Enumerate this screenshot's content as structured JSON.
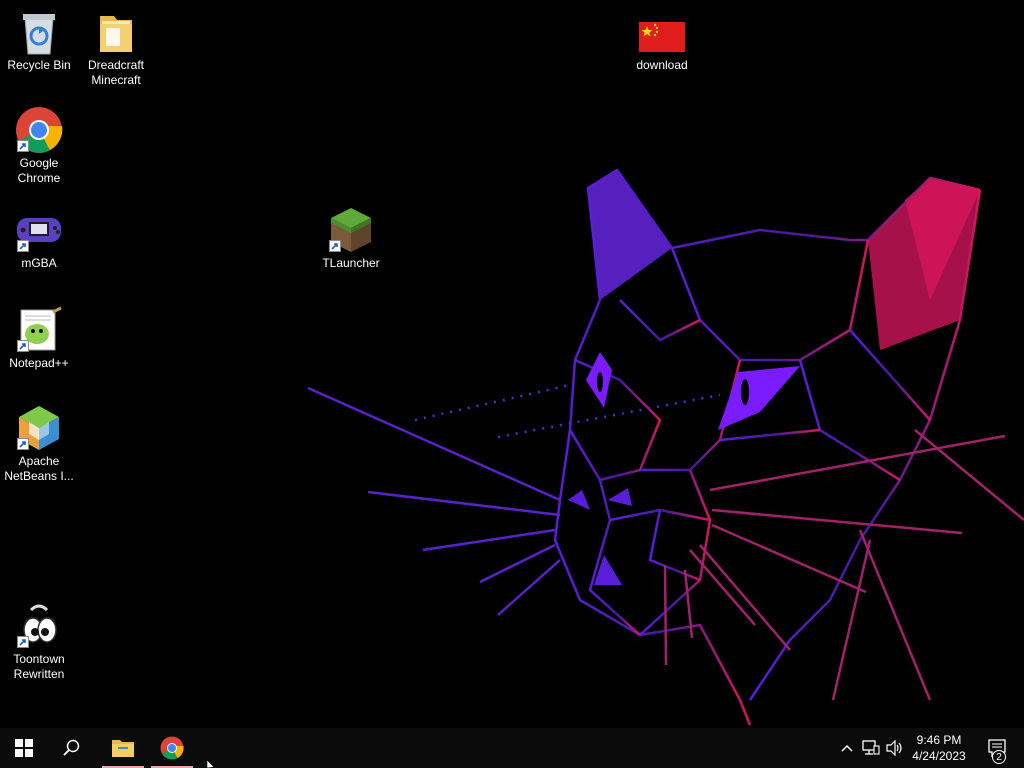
{
  "desktop": {
    "icons": [
      {
        "label": "Recycle Bin",
        "icon": "recycle-bin-icon"
      },
      {
        "label": "Dreadcraft Minecraft",
        "icon": "folder-icon"
      },
      {
        "label": "download",
        "icon": "china-flag-image-icon"
      },
      {
        "label": "Google Chrome",
        "icon": "chrome-icon"
      },
      {
        "label": "mGBA",
        "icon": "gameboy-advance-icon"
      },
      {
        "label": "TLauncher",
        "icon": "minecraft-grass-block-icon"
      },
      {
        "label": "Notepad++",
        "icon": "notepad-plus-plus-icon"
      },
      {
        "label": "Apache NetBeans I...",
        "icon": "netbeans-cube-icon"
      },
      {
        "label": "Toontown Rewritten",
        "icon": "toontown-icon"
      }
    ]
  },
  "taskbar": {
    "start_icon": "windows-start-icon",
    "search_icon": "search-icon",
    "pinned": [
      {
        "name": "File Explorer",
        "icon": "folder-icon",
        "active": true
      },
      {
        "name": "Google Chrome",
        "icon": "chrome-icon",
        "active": true
      }
    ],
    "tray": {
      "chevron_icon": "chevron-up-icon",
      "network_icon": "network-icon",
      "volume_icon": "volume-icon",
      "time": "9:46 PM",
      "date": "4/24/2023",
      "notification_count": "2"
    }
  },
  "colors": {
    "wallpaper_purple": "#6a1fd0",
    "wallpaper_magenta": "#c2185b",
    "taskbar_bg": "#0b0b0b",
    "active_indicator": "#e8a5a5"
  }
}
